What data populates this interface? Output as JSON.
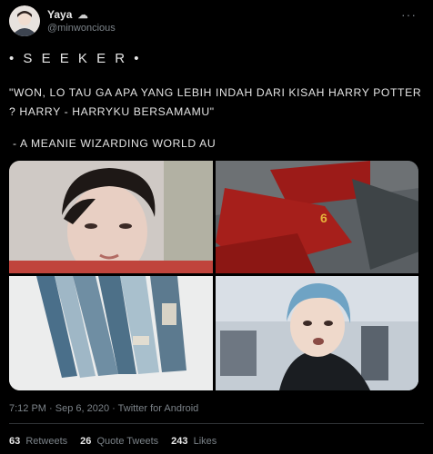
{
  "author": {
    "name": "Yaya",
    "badge_icon": "cloud-icon",
    "handle": "@minwoncious"
  },
  "tweet": {
    "heading": "• S E E K E R •",
    "quote": "\"WON, LO TAU GA APA YANG LEBIH INDAH DARI KISAH HARRY POTTER ? HARRY - HARRYKU BERSAMAMU\"",
    "subtitle": "- A MEANIE WIZARDING WORLD AU"
  },
  "media": {
    "images": [
      {
        "name": "portrait-dark-hair"
      },
      {
        "name": "quidditch-players"
      },
      {
        "name": "blue-books"
      },
      {
        "name": "blue-hair-selfie"
      }
    ]
  },
  "meta": {
    "timestamp": "7:12 PM · Sep 6, 2020 · Twitter for Android"
  },
  "stats": {
    "retweets_count": "63",
    "retweets_label": "Retweets",
    "quotes_count": "26",
    "quotes_label": "Quote Tweets",
    "likes_count": "243",
    "likes_label": "Likes"
  }
}
